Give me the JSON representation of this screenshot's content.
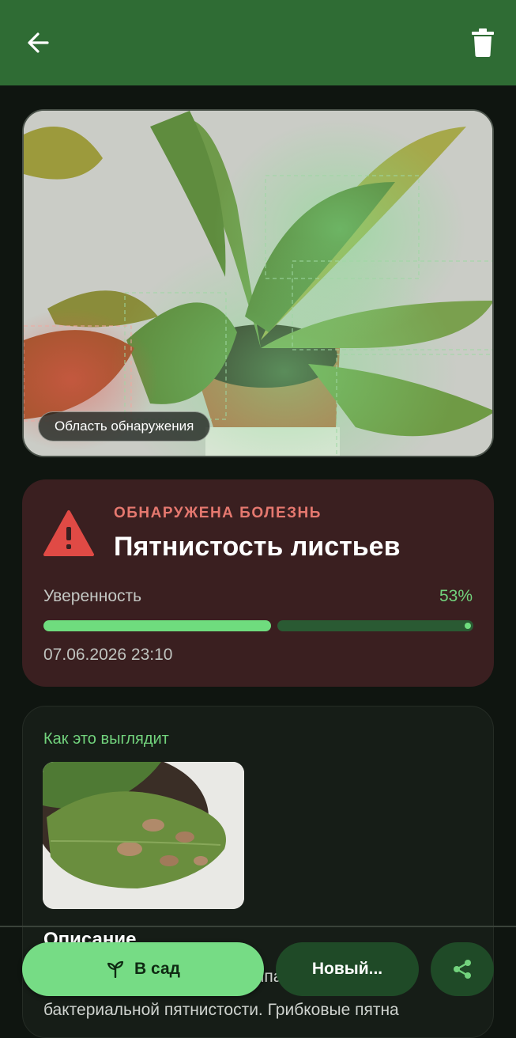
{
  "toolbar": {
    "back_icon": "arrow-left-icon",
    "delete_icon": "trash-icon"
  },
  "photo": {
    "chip_label": "Область обнаружения"
  },
  "result": {
    "eyebrow": "ОБНАРУЖЕНА БОЛЕЗНЬ",
    "disease_name": "Пятнистость листьев",
    "confidence_label": "Уверенность",
    "confidence_value": "53%",
    "confidence_fraction": 0.53,
    "date": "07.06.2026 23:10",
    "icon": "warning-triangle-icon"
  },
  "info": {
    "looks_label": "Как это выглядит",
    "description_title": "Описание",
    "description_text": "Пятнистость листьев — группа грибковых и бактериальной пятнистости. Грибковые пятна"
  },
  "actions": {
    "add_to_garden": "В сад",
    "new_scan": "Новый...",
    "share_icon": "share-icon"
  },
  "colors": {
    "accent": "#76dc85",
    "topbar": "#2f6c34",
    "alert": "#e5786f",
    "alert_card": "#3a1f20"
  }
}
